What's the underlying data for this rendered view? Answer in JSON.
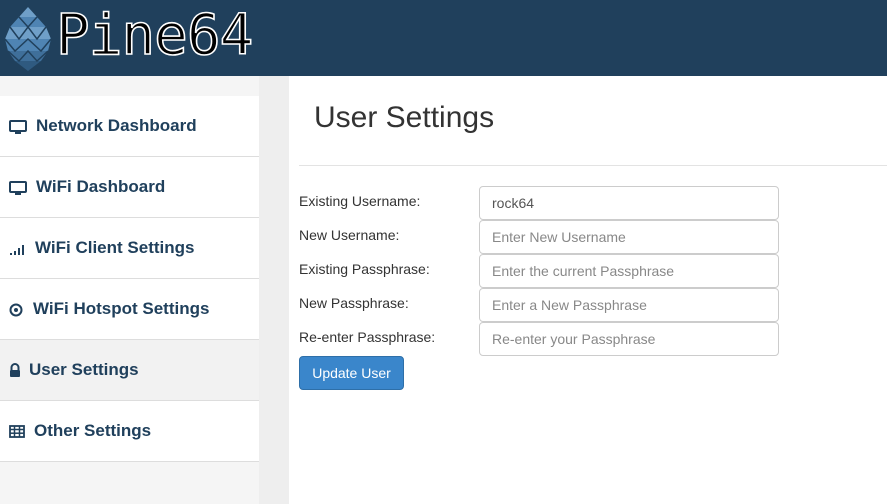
{
  "brand": {
    "name": "Pine64",
    "logo_icon": "pinecone-icon"
  },
  "sidebar": {
    "items": [
      {
        "label": "Network Dashboard",
        "icon": "monitor-icon"
      },
      {
        "label": "WiFi Dashboard",
        "icon": "monitor-icon"
      },
      {
        "label": "WiFi Client Settings",
        "icon": "signal-icon"
      },
      {
        "label": "WiFi Hotspot Settings",
        "icon": "target-icon"
      },
      {
        "label": "User Settings",
        "icon": "lock-icon",
        "active": true
      },
      {
        "label": "Other Settings",
        "icon": "table-icon"
      }
    ]
  },
  "main": {
    "title": "User Settings",
    "form": {
      "existing_username": {
        "label": "Existing Username:",
        "value": "rock64",
        "placeholder": ""
      },
      "new_username": {
        "label": "New Username:",
        "value": "",
        "placeholder": "Enter New Username"
      },
      "existing_passphrase": {
        "label": "Existing Passphrase:",
        "value": "",
        "placeholder": "Enter the current Passphrase"
      },
      "new_passphrase": {
        "label": "New Passphrase:",
        "value": "",
        "placeholder": "Enter a New Passphrase"
      },
      "reenter_passphrase": {
        "label": "Re-enter Passphrase:",
        "value": "",
        "placeholder": "Re-enter your Passphrase"
      },
      "submit_label": "Update User"
    }
  },
  "colors": {
    "topbar": "#20405c",
    "nav_text": "#20405c",
    "button": "#3a86cb"
  }
}
